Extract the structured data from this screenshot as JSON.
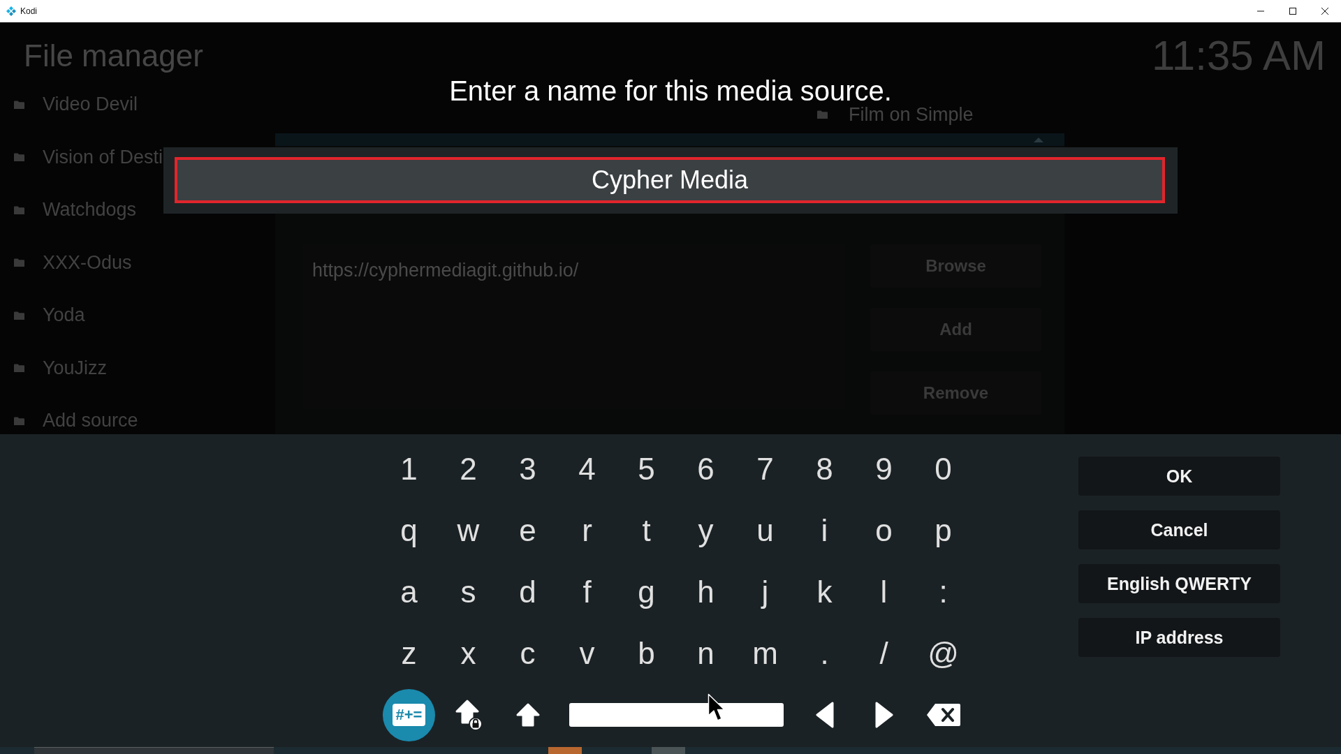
{
  "window": {
    "title": "Kodi"
  },
  "file_manager": {
    "title": "File manager",
    "clock": "11:35 AM",
    "sources": [
      "Video Devil",
      "Vision of Desti",
      "Watchdogs",
      "XXX-Odus",
      "Yoda",
      "YouJizz",
      "Add source"
    ],
    "list_item": "Film on Simple",
    "source_dialog": {
      "path": "https://cyphermediagit.github.io/",
      "buttons": [
        "Browse",
        "Add",
        "Remove"
      ]
    }
  },
  "name_dialog": {
    "heading": "Enter a name for this media source.",
    "value": "Cypher Media",
    "focused": true
  },
  "keyboard": {
    "rows": [
      [
        "1",
        "2",
        "3",
        "4",
        "5",
        "6",
        "7",
        "8",
        "9",
        "0"
      ],
      [
        "q",
        "w",
        "e",
        "r",
        "t",
        "y",
        "u",
        "i",
        "o",
        "p"
      ],
      [
        "a",
        "s",
        "d",
        "f",
        "g",
        "h",
        "j",
        "k",
        "l",
        ":"
      ],
      [
        "z",
        "x",
        "c",
        "v",
        "b",
        "n",
        "m",
        ".",
        "/",
        "@"
      ]
    ],
    "bottom_keys": [
      {
        "kind": "symbols",
        "label": "#+=",
        "focused": true
      },
      {
        "kind": "caps_lock",
        "focused": false
      },
      {
        "kind": "shift",
        "focused": false
      },
      {
        "kind": "space",
        "focused": false
      },
      {
        "kind": "left",
        "focused": false
      },
      {
        "kind": "right",
        "focused": false
      },
      {
        "kind": "backspace",
        "focused": false
      }
    ],
    "buttons": [
      "OK",
      "Cancel",
      "English QWERTY",
      "IP address"
    ]
  }
}
